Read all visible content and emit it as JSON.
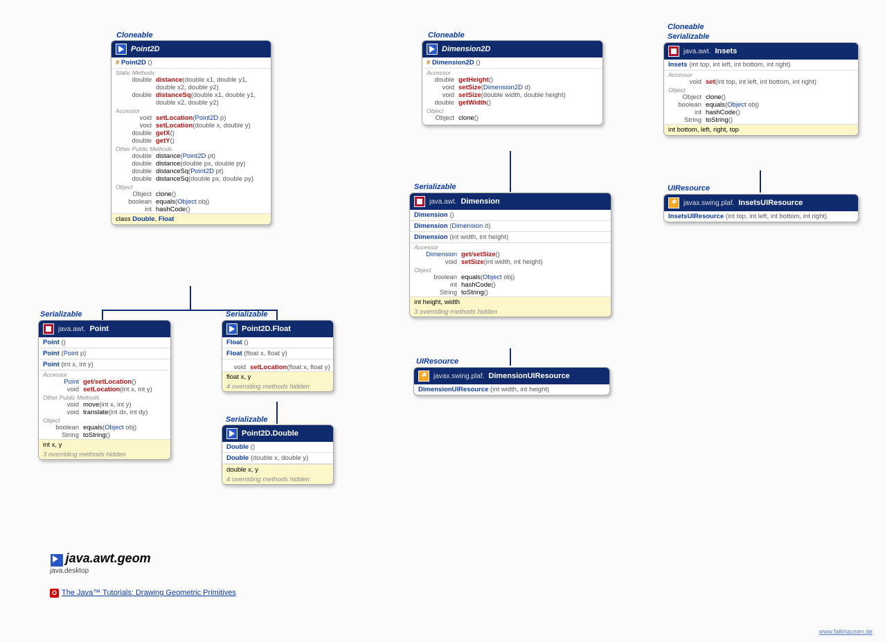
{
  "ifaces": {
    "cloneable": "Cloneable",
    "serializable": "Serializable",
    "uiresource": "UIResource"
  },
  "point2d": {
    "name": "Point2D",
    "ctor": "Point2D",
    "s_static": "Static Methods",
    "m_dist": "distance",
    "m_distSq": "distanceSq",
    "p_dist": "(double x1, double y1,",
    "p_dist2": "double x2, double y2)",
    "s_acc": "Accessor",
    "m_setLoc": "setLocation",
    "p_setLocP": "(Point2D p)",
    "p_setLocD": "(double x, double y)",
    "m_getX": "getX",
    "m_getY": "getY",
    "s_other": "Other Public Methods",
    "p_distPt": "(Point2D pt)",
    "p_distPxy": "(double px, double py)",
    "s_obj": "Object",
    "m_clone": "clone",
    "m_eq": "equals",
    "p_eq": "(Object obj)",
    "m_hash": "hashCode",
    "nested": "class",
    "nested_d": "Double",
    "nested_f": "Float"
  },
  "point": {
    "pkg": "java.awt.",
    "name": "Point",
    "c1": "Point",
    "p2": "(Point p)",
    "p3": "(int x, int y)",
    "s_acc": "Accessor",
    "m_gsl": "get/setLocation",
    "m_setLoc": "setLocation",
    "p_setLoc": "(int x, int y)",
    "s_other": "Other Public Methods",
    "m_move": "move",
    "p_move": "(int x, int y)",
    "m_tr": "translate",
    "p_tr": "(int dx, int dy)",
    "s_obj": "Object",
    "m_eq": "equals",
    "p_eq": "(Object obj)",
    "m_ts": "toString",
    "fields": "int x, y",
    "hidden": "3 overriding methods hidden"
  },
  "p2df": {
    "name": "Point2D.Float",
    "c": "Float",
    "p": "(float x, float y)",
    "m_setLoc": "setLocation",
    "p_setLoc": "(float x, float y)",
    "fields": "float x, y",
    "hidden": "4 overriding methods hidden"
  },
  "p2dd": {
    "name": "Point2D.Double",
    "c": "Double",
    "p": "(double x, double y)",
    "fields": "double x, y",
    "hidden": "4 overriding methods hidden"
  },
  "dim2d": {
    "name": "Dimension2D",
    "ctor": "Dimension2D",
    "s_acc": "Accessor",
    "m_getH": "getHeight",
    "m_setSz": "setSize",
    "p_setSzD": "(Dimension2D d)",
    "p_setSzWH": "(double width, double height)",
    "m_getW": "getWidth",
    "s_obj": "Object",
    "m_clone": "clone"
  },
  "dim": {
    "pkg": "java.awt.",
    "name": "Dimension",
    "c": "Dimension",
    "p2": "(Dimension d)",
    "p3": "(int width, int height)",
    "s_acc": "Accessor",
    "m_gsl": "get/setSize",
    "m_setSz": "setSize",
    "p_setSz": "(int width, int height)",
    "s_obj": "Object",
    "m_eq": "equals",
    "p_eq": "(Object obj)",
    "m_hash": "hashCode",
    "m_ts": "toString",
    "fields": "int height, width",
    "hidden": "3 overriding methods hidden"
  },
  "dimui": {
    "pkg": "javax.swing.plaf.",
    "name": "DimensionUIResource",
    "c": "DimensionUIResource",
    "p": "(int width, int height)"
  },
  "insets": {
    "pkg": "java.awt.",
    "name": "Insets",
    "c": "Insets",
    "p": "(int top, int left, int bottom, int right)",
    "s_acc": "Accessor",
    "m_set": "set",
    "p_set": "(int top, int left, int bottom, int right)",
    "s_obj": "Object",
    "m_clone": "clone",
    "m_eq": "equals",
    "p_eq": "(Object obj)",
    "m_hash": "hashCode",
    "m_ts": "toString",
    "fields": "int bottom, left, right, top"
  },
  "insetsui": {
    "pkg": "javax.swing.plaf.",
    "name": "InsetsUIResource",
    "c": "InsetsUIResource",
    "p": "(int top, int left, int bottom, int right)"
  },
  "title": {
    "pkg": "java.awt.geom",
    "module": "java.desktop",
    "tutorial": "The Java™ Tutorials: Drawing Geometric Primitives"
  },
  "types": {
    "void": "void",
    "double": "double",
    "int": "int",
    "bool": "boolean",
    "obj": "Object",
    "str": "String",
    "point": "Point",
    "dim": "Dimension"
  },
  "credit": "www.falkhausen.de"
}
